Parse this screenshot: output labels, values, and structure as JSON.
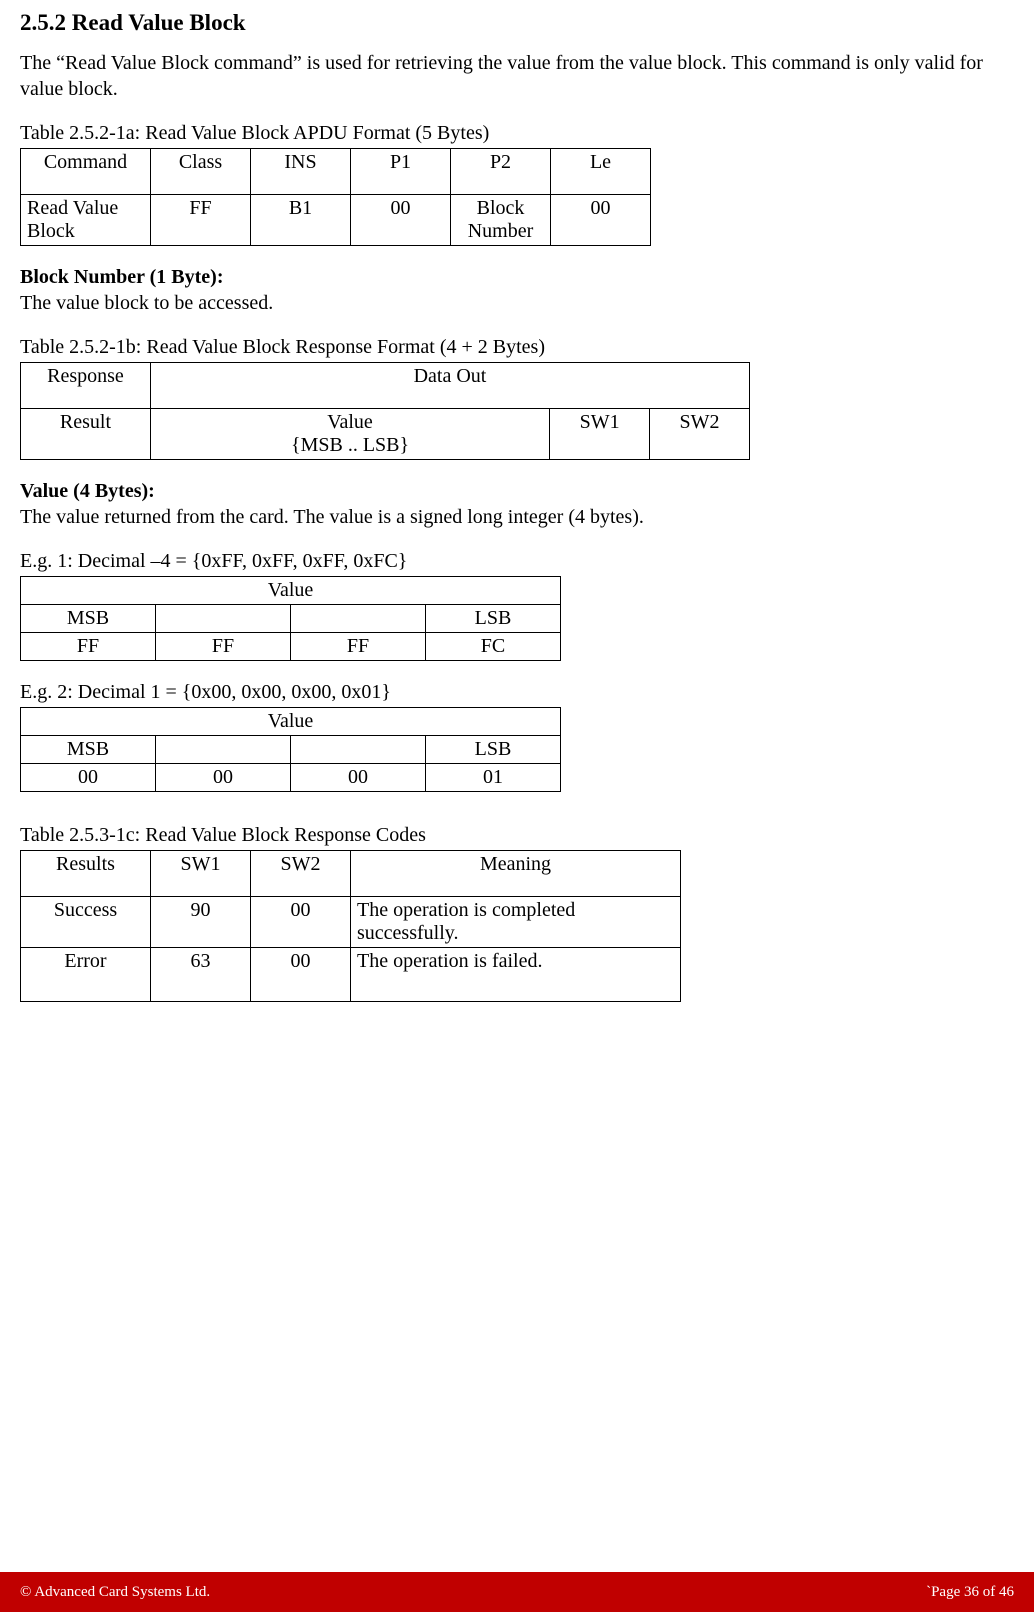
{
  "heading": "2.5.2 Read Value Block",
  "intro": "The “Read Value Block command” is used for retrieving the value from the value block. This command is only valid for value block.",
  "table1a": {
    "caption": "Table 2.5.2-1a: Read Value Block APDU Format (5 Bytes)",
    "headers": [
      "Command",
      "Class",
      "INS",
      "P1",
      "P2",
      "Le"
    ],
    "row": [
      "Read Value Block",
      "FF",
      "B1",
      "00",
      "Block Number",
      "00"
    ]
  },
  "block_num_label": "Block Number (1 Byte):",
  "block_num_desc": "The value block to be accessed.",
  "table1b": {
    "caption": "Table 2.5.2-1b: Read Value Block Response Format (4 + 2 Bytes)",
    "h_response": "Response",
    "h_dataout": "Data Out",
    "r_result": "Result",
    "r_value_line1": "Value",
    "r_value_line2": "{MSB .. LSB}",
    "r_sw1": "SW1",
    "r_sw2": "SW2"
  },
  "value_label": "Value (4 Bytes):",
  "value_desc": "The value returned from the card. The value is a signed long integer (4 bytes).",
  "eg1": {
    "caption": "E.g. 1: Decimal  –4 = {0xFF, 0xFF, 0xFF, 0xFC}",
    "title": "Value",
    "msb": "MSB",
    "lsb": "LSB",
    "cells": [
      "FF",
      "FF",
      "FF",
      "FC"
    ]
  },
  "eg2": {
    "caption": "E.g. 2: Decimal 1 = {0x00, 0x00, 0x00, 0x01}",
    "title": "Value",
    "msb": "MSB",
    "lsb": "LSB",
    "cells": [
      "00",
      "00",
      "00",
      "01"
    ]
  },
  "table1c": {
    "caption": "Table 2.5.3-1c: Read Value Block Response Codes",
    "headers": [
      "Results",
      "SW1",
      "SW2",
      "Meaning"
    ],
    "rows": [
      {
        "result": "Success",
        "sw1": "90",
        "sw2": "00",
        "meaning": "The operation is completed successfully."
      },
      {
        "result": "Error",
        "sw1": "63",
        "sw2": "00",
        "meaning": "The operation is failed."
      }
    ]
  },
  "footer": {
    "left": "© Advanced Card Systems Ltd.",
    "right": "`Page 36 of 46"
  }
}
